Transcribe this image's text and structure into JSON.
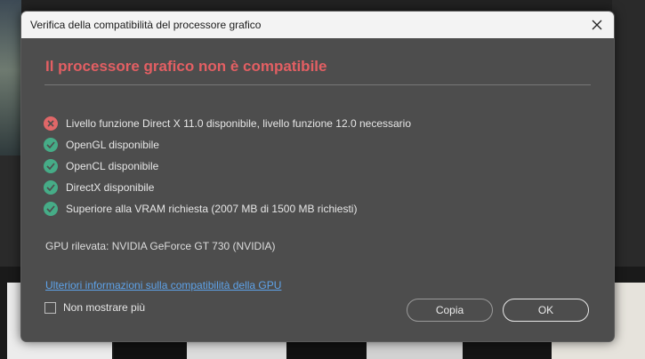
{
  "dialog": {
    "title": "Verifica della compatibilità del processore grafico",
    "heading": "Il processore grafico non è compatibile",
    "checks": [
      {
        "status": "error",
        "label": "Livello funzione Direct X 11.0 disponibile, livello funzione 12.0 necessario"
      },
      {
        "status": "ok",
        "label": "OpenGL disponibile"
      },
      {
        "status": "ok",
        "label": "OpenCL disponibile"
      },
      {
        "status": "ok",
        "label": "DirectX disponibile"
      },
      {
        "status": "ok",
        "label": "Superiore alla VRAM richiesta (2007 MB di 1500 MB richiesti)"
      }
    ],
    "gpu_detected": "GPU rilevata: NVIDIA GeForce GT 730 (NVIDIA)",
    "more_info_link": "Ulteriori informazioni sulla compatibilità della GPU",
    "dont_show_label": "Non mostrare più",
    "copy_label": "Copia",
    "ok_label": "OK"
  },
  "colors": {
    "error": "#e06768",
    "ok": "#46ac87",
    "heading": "#e35f63",
    "link": "#5ea3ea"
  }
}
